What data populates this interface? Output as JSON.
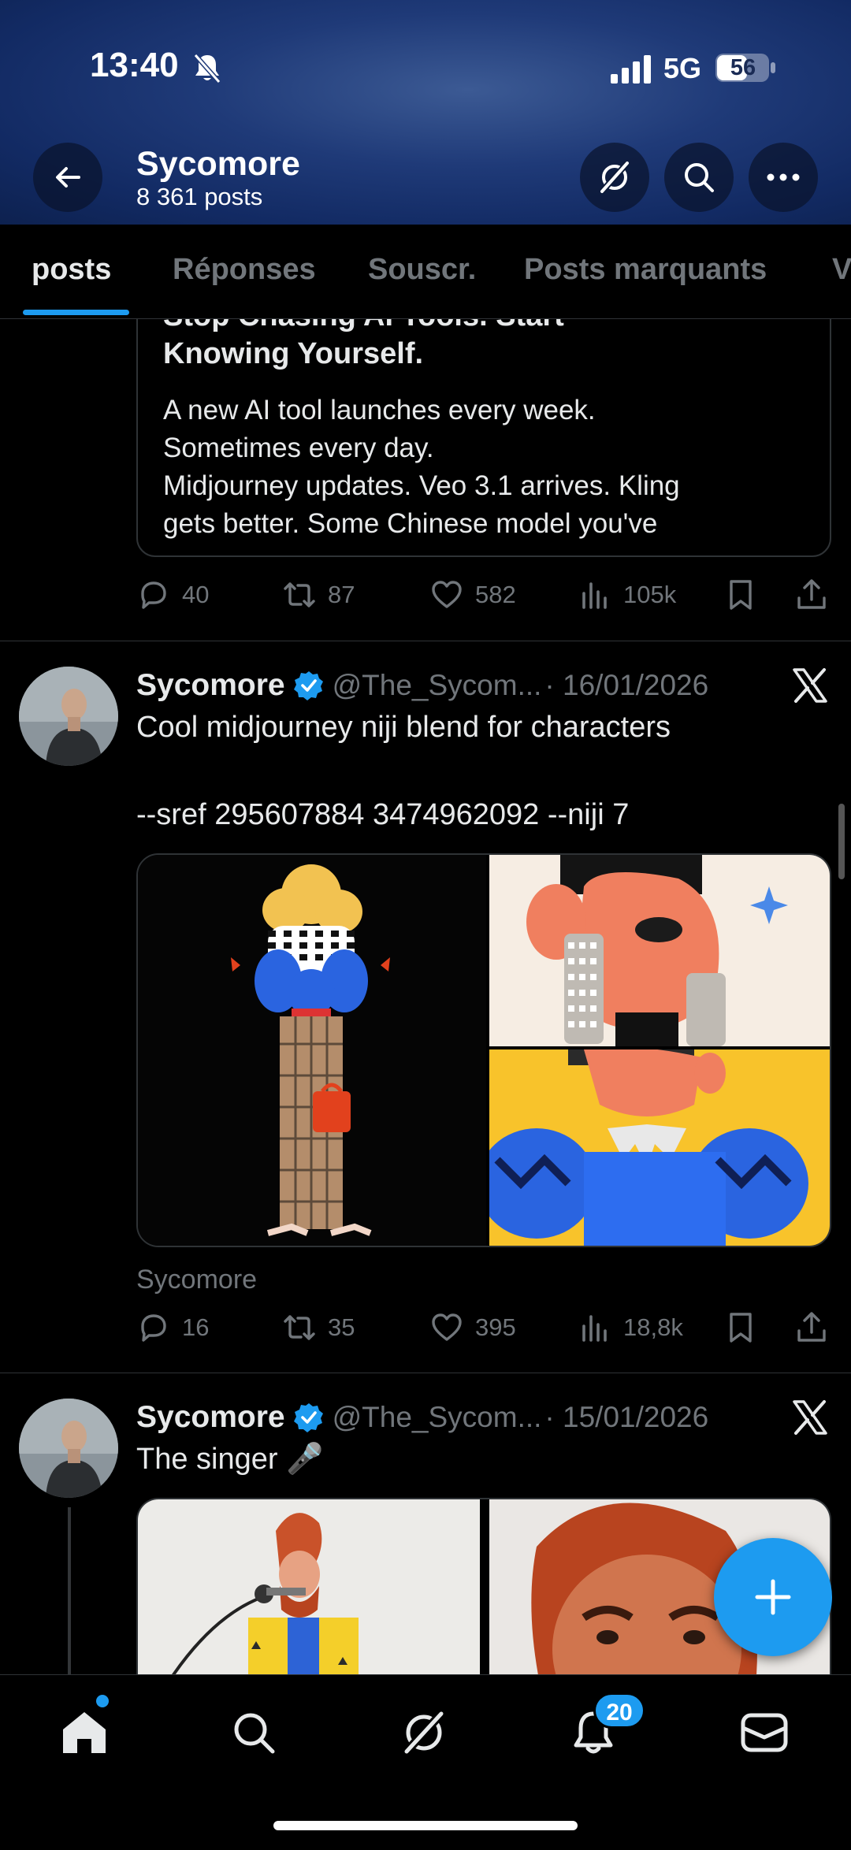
{
  "status_bar": {
    "time": "13:40",
    "network": "5G",
    "battery": "56"
  },
  "header": {
    "name": "Sycomore",
    "posts_count": "8 361 posts"
  },
  "tabs": [
    {
      "label": "posts"
    },
    {
      "label": "Réponses"
    },
    {
      "label": "Souscr."
    },
    {
      "label": "Posts marquants"
    },
    {
      "label": "V"
    }
  ],
  "quote": {
    "title_lines": [
      "Stop Chasing AI Tools. Start",
      "Knowing Yourself."
    ],
    "body_lines": [
      "A new AI tool launches every week.",
      "Sometimes every day.",
      "Midjourney updates. Veo 3.1 arrives. Kling",
      "gets better. Some Chinese model you've"
    ]
  },
  "post0_stats": {
    "replies": "40",
    "reposts": "87",
    "likes": "582",
    "views": "105k"
  },
  "posts": [
    {
      "name": "Sycomore",
      "handle": "@The_Sycom...",
      "date": "· 16/01/2026",
      "text_line1": "Cool midjourney niji blend for characters",
      "text_line2": "--sref 295607884 3474962092 --niji 7",
      "via": "Sycomore",
      "stats": {
        "replies": "16",
        "reposts": "35",
        "likes": "395",
        "views": "18,8k"
      }
    },
    {
      "name": "Sycomore",
      "handle": "@The_Sycom...",
      "date": "· 15/01/2026",
      "text_line1": "The singer 🎤"
    }
  ],
  "notifications_badge": "20",
  "colors": {
    "accent": "#1d9bf0",
    "muted": "#71767b",
    "divider": "#2f3336"
  }
}
